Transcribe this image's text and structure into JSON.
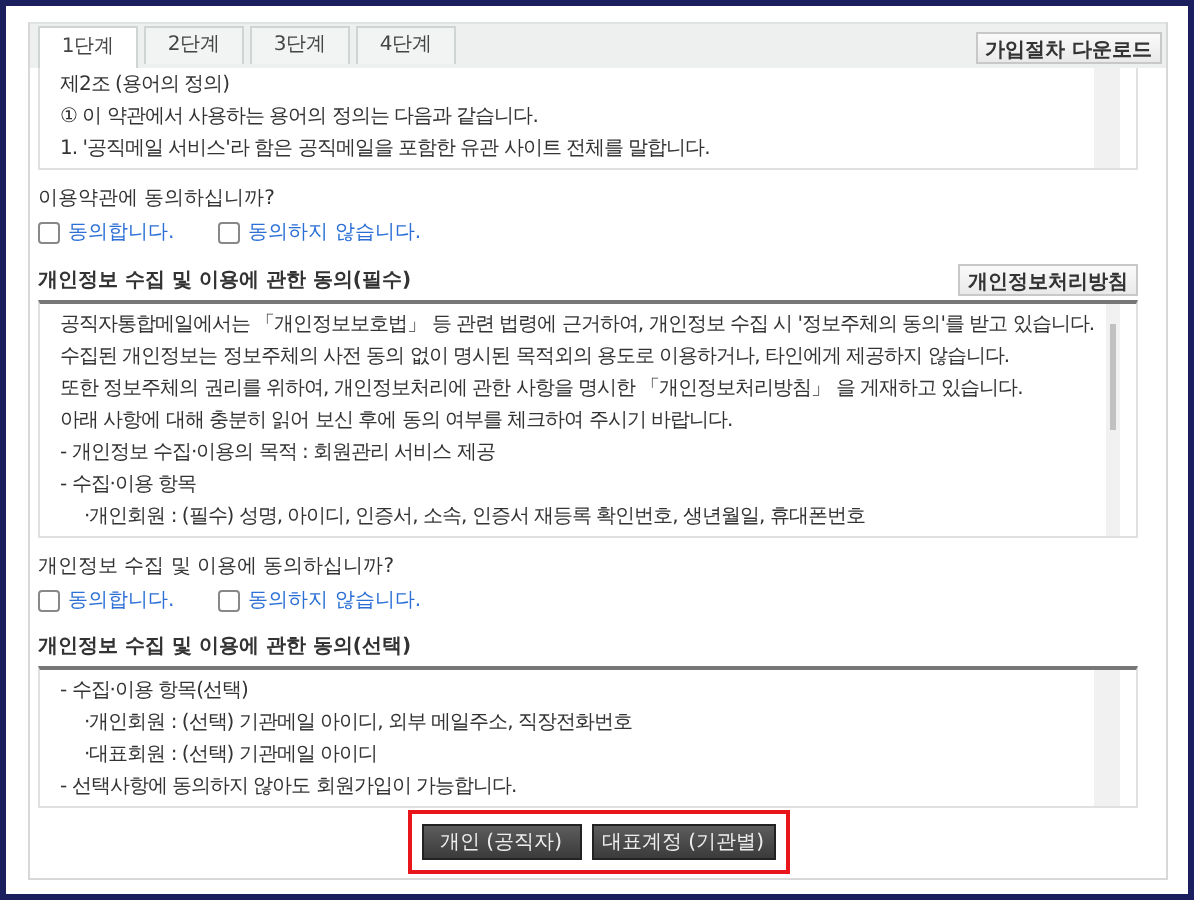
{
  "tabs": [
    {
      "label": "1단계",
      "selected": true
    },
    {
      "label": "2단계",
      "selected": false
    },
    {
      "label": "3단계",
      "selected": false
    },
    {
      "label": "4단계",
      "selected": false
    }
  ],
  "download_button": "가입절차 다운로드",
  "terms": {
    "lines": [
      {
        "text": "제2조 (용어의 정의)"
      },
      {
        "text": "① 이 약관에서 사용하는 용어의 정의는 다음과 같습니다."
      },
      {
        "text": "1. '공직메일 서비스'라 함은 공직메일을 포함한 유관 사이트 전체를 말합니다."
      }
    ],
    "question": "이용약관에 동의하십니까?",
    "options": [
      {
        "label": "동의합니다.",
        "checked": false
      },
      {
        "label": "동의하지 않습니다.",
        "checked": false
      }
    ]
  },
  "sections": [
    {
      "title": "개인정보 수집 및 이용에 관한 동의(필수)",
      "button": "개인정보처리방침",
      "lines": [
        {
          "text": "공직자통합메일에서는 「개인정보보호법」 등 관련 법령에 근거하여, 개인정보 수집 시 '정보주체의 동의'를 받고 있습니다."
        },
        {
          "text": "수집된 개인정보는 정보주체의 사전 동의 없이 명시된 목적외의 용도로 이용하거나, 타인에게 제공하지 않습니다."
        },
        {
          "text": "또한 정보주체의 권리를 위하여, 개인정보처리에 관한 사항을 명시한 「개인정보처리방침」 을 게재하고 있습니다."
        },
        {
          "text": "아래 사항에 대해 충분히 읽어 보신 후에 동의 여부를 체크하여 주시기 바랍니다."
        },
        {
          "text": "- 개인정보 수집·이용의 목적 : 회원관리 서비스 제공"
        },
        {
          "text": "- 수집·이용 항목",
          "children": [
            {
              "text": "·개인회원 : (필수) 성명, 아이디, 인증서, 소속, 인증서 재등록 확인번호, 생년월일, 휴대폰번호"
            }
          ]
        }
      ],
      "question": "개인정보 수집 및 이용에 동의하십니까?",
      "options": [
        {
          "label": "동의합니다.",
          "checked": false
        },
        {
          "label": "동의하지 않습니다.",
          "checked": false
        }
      ]
    },
    {
      "title": "개인정보 수집 및 이용에 관한 동의(선택)",
      "lines": [
        {
          "text": "- 수집·이용 항목(선택)",
          "children": [
            {
              "text": "·개인회원 : (선택) 기관메일 아이디, 외부 메일주소, 직장전화번호"
            },
            {
              "text": "·대표회원 : (선택) 기관메일 아이디"
            }
          ]
        },
        {
          "text": "- 선택사항에 동의하지 않아도 회원가입이 가능합니다."
        }
      ]
    }
  ],
  "bottom_buttons": [
    "개인 (공직자)",
    "대표계정 (기관별)"
  ]
}
